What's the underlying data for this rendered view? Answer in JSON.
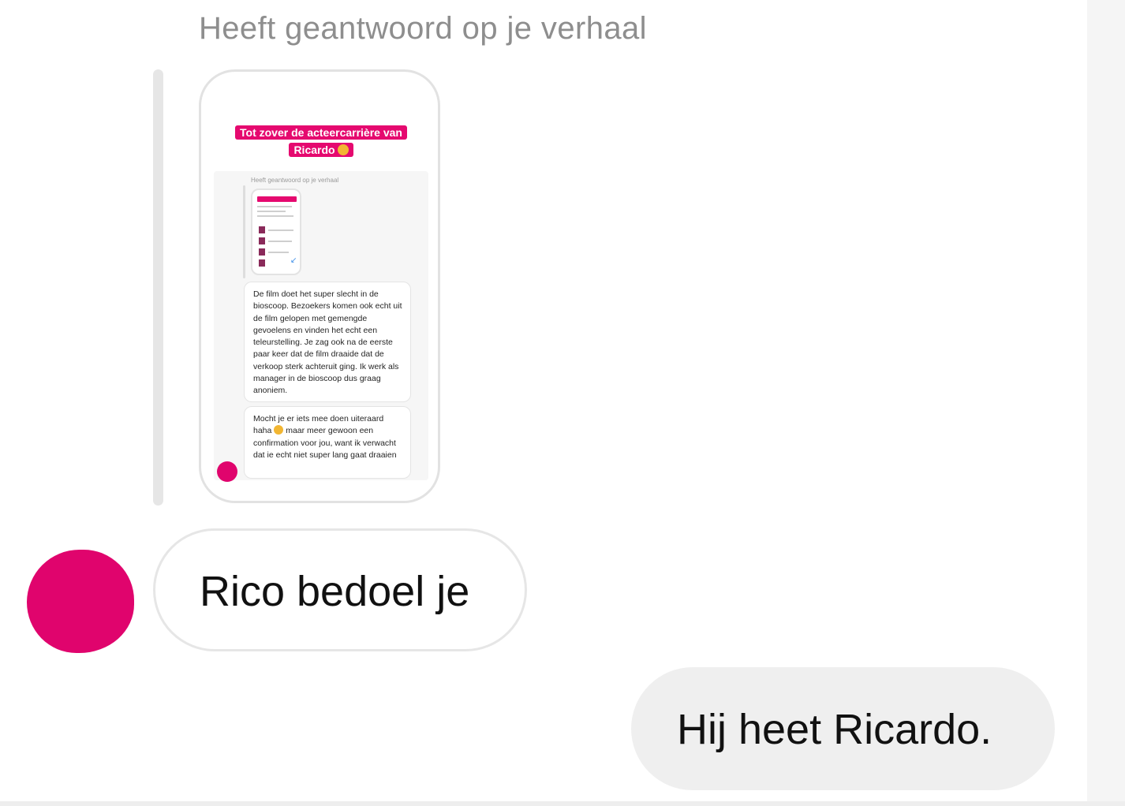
{
  "conversation": {
    "reply_caption": "Heeft geantwoord op je verhaal",
    "story": {
      "title_line1": "Tot zover de acteercarrière van",
      "title_line2": "Ricardo",
      "inner_caption": "Heeft geantwoord op je verhaal",
      "message1": "De film doet het super slecht in de bioscoop. Bezoekers komen ook echt uit de film gelopen met gemengde gevoelens en vinden het echt een teleurstelling. Je zag ook na de eerste paar keer dat de film draaide dat de verkoop sterk achteruit ging. Ik werk als manager in de bioscoop dus graag anoniem.",
      "message2_part1": "Mocht je er iets mee doen uiteraard haha",
      "message2_part2": "maar meer gewoon een confirmation voor jou, want ik verwacht dat ie echt niet super lang gaat draaien"
    },
    "incoming_message": "Rico bedoel je",
    "outgoing_message": "Hij heet Ricardo."
  },
  "colors": {
    "accent_pink": "#e0046d",
    "caption_gray": "#8e8e8e",
    "outgoing_bubble": "#efefef"
  },
  "icons": {
    "avatar": "redacted-avatar-circle",
    "emoji": "laughing-emoji"
  }
}
